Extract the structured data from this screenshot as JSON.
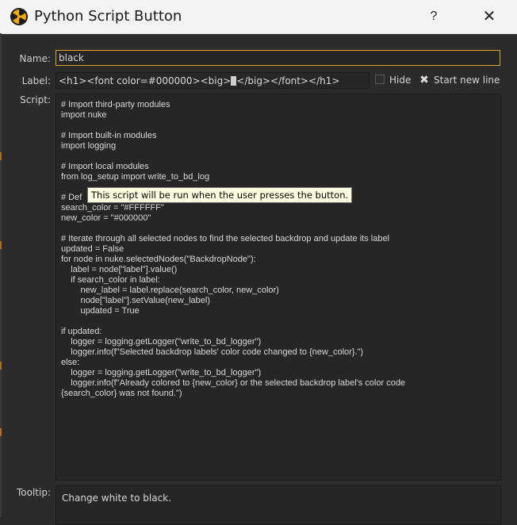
{
  "window": {
    "title": "Python Script Button",
    "help": "?",
    "close": "✕"
  },
  "fields": {
    "name_label": "Name:",
    "name_value": "black",
    "label_label": "Label:",
    "label_value_pre": "<h1><font color=#000000><big>",
    "label_value_post": "</big></font></h1>",
    "hide_label": "Hide",
    "hide_checked": false,
    "start_new_line_label": "Start new line",
    "start_new_line_checked": true,
    "script_label": "Script:",
    "tooltip_label": "Tooltip:",
    "tooltip_value": "Change white to black."
  },
  "script_lines": [
    "# Import third-party modules",
    "import nuke",
    "",
    "# Import built-in modules",
    "import logging",
    "",
    "# Import local modules",
    "from log_setup import write_to_bd_log",
    "",
    "# Def",
    "search_color = \"#FFFFFF\"",
    "new_color = \"#000000\"",
    "",
    "# Iterate through all selected nodes to find the selected backdrop and update its label",
    "updated = False",
    "for node in nuke.selectedNodes(\"BackdropNode\"):",
    "    label = node[\"label\"].value()",
    "    if search_color in label:",
    "        new_label = label.replace(search_color, new_color)",
    "        node[\"label\"].setValue(new_label)",
    "        updated = True",
    "",
    "if updated:",
    "    logger = logging.getLogger(\"write_to_bd_logger\")",
    "    logger.info(f\"Selected backdrop labels' color code changed to {new_color}.\")",
    "else:",
    "    logger = logging.getLogger(\"write_to_bd_logger\")",
    "    logger.info(f\"Already colored to {new_color} or the selected backdrop label's color code",
    "{search_color} was not found.\")"
  ],
  "hover_tooltip": "This script will be run when the user presses the button.",
  "icons": {
    "app": "nuke-logo-icon",
    "hide_checkbox": "checkbox-icon",
    "newline_checkbox": "checkmark-icon"
  },
  "colors": {
    "name_focus_border": "#e4a12f",
    "tooltip_bg": "#ffffe1",
    "dialog_bg": "#2b2b2b"
  }
}
